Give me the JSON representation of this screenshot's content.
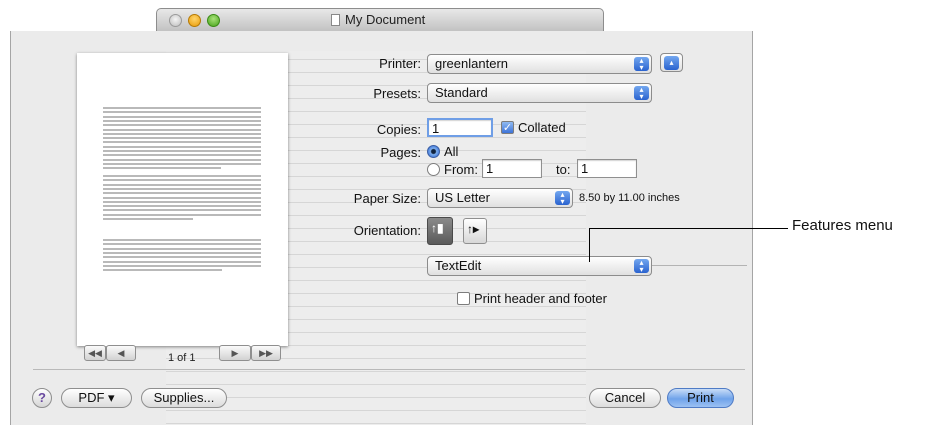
{
  "window": {
    "title": "My Document"
  },
  "print_dialog": {
    "printer": {
      "label": "Printer:",
      "value": "greenlantern"
    },
    "presets": {
      "label": "Presets:",
      "value": "Standard"
    },
    "copies": {
      "label": "Copies:",
      "value": "1",
      "collated_label": "Collated",
      "collated": true
    },
    "pages": {
      "label": "Pages:",
      "all_label": "All",
      "from_label": "From:",
      "from_value": "1",
      "to_label": "to:",
      "to_value": "1",
      "selected": "All"
    },
    "paper_size": {
      "label": "Paper Size:",
      "value": "US Letter",
      "dimensions": "8.50 by 11.00 inches"
    },
    "orientation": {
      "label": "Orientation:",
      "selected": "portrait"
    },
    "features_menu": {
      "value": "TextEdit"
    },
    "print_header_footer": {
      "label": "Print header and footer",
      "checked": false
    },
    "preview_nav": {
      "page_indicator": "1 of 1",
      "first": "◀◀",
      "prev": "◀",
      "next": "▶",
      "last": "▶▶"
    },
    "buttons": {
      "help": "?",
      "pdf": "PDF ▾",
      "supplies": "Supplies...",
      "cancel": "Cancel",
      "print": "Print"
    }
  },
  "annotation": {
    "features_menu": "Features menu"
  }
}
